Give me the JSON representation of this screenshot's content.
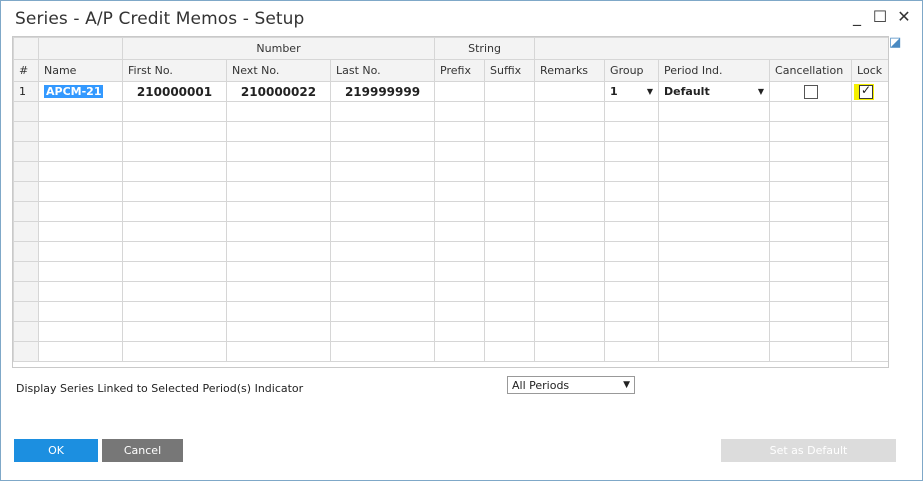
{
  "window": {
    "title": "Series - A/P Credit Memos - Setup",
    "minimize": "_",
    "maximize": "☐",
    "close": "✕"
  },
  "grid": {
    "group_headers": {
      "number": "Number",
      "string": "String"
    },
    "columns": [
      "#",
      "Name",
      "First No.",
      "Next No.",
      "Last No.",
      "Prefix",
      "Suffix",
      "Remarks",
      "Group",
      "Period Ind.",
      "Cancellation",
      "Lock"
    ],
    "rows": [
      {
        "row_num": "1",
        "name": "APCM-21",
        "first_no": "210000001",
        "next_no": "210000022",
        "last_no": "219999999",
        "prefix": "",
        "suffix": "",
        "remarks": "",
        "group": "1",
        "period_ind": "Default",
        "cancellation": false,
        "lock": true
      }
    ],
    "empty_rows": 13,
    "corner_icon": "expand-arrow-icon"
  },
  "footer": {
    "period_label": "Display Series Linked to Selected Period(s) Indicator",
    "period_value": "All Periods"
  },
  "buttons": {
    "ok": "OK",
    "cancel": "Cancel",
    "set_default": "Set as Default"
  },
  "colors": {
    "ok_button": "#1c8fe0",
    "cancel_button": "#777777",
    "selection": "#3399ff",
    "lock_highlight": "#f5f000"
  }
}
